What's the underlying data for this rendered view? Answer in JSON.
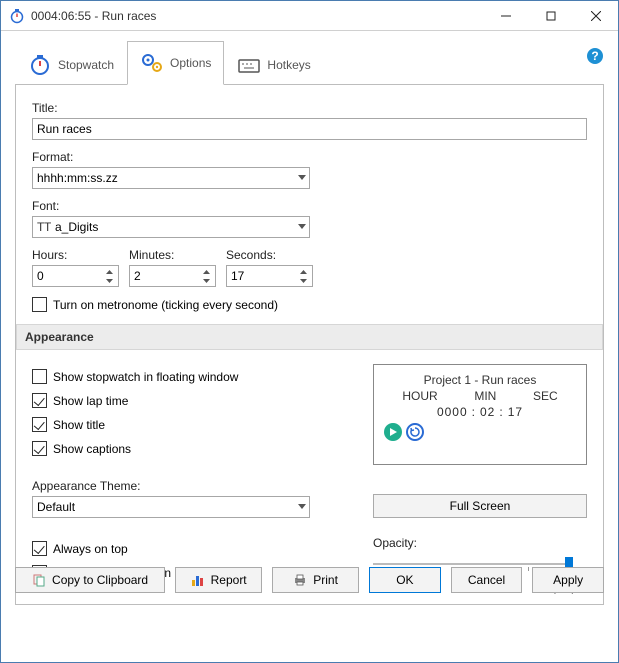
{
  "window": {
    "title": "0004:06:55 - Run races"
  },
  "tabs": {
    "stopwatch": "Stopwatch",
    "options": "Options",
    "hotkeys": "Hotkeys"
  },
  "fields": {
    "title_label": "Title:",
    "title_value": "Run races",
    "format_label": "Format:",
    "format_value": "hhhh:mm:ss.zz",
    "font_label": "Font:",
    "font_value": "a_Digits",
    "hours_label": "Hours:",
    "hours_value": "0",
    "minutes_label": "Minutes:",
    "minutes_value": "2",
    "seconds_label": "Seconds:",
    "seconds_value": "17",
    "metronome": "Turn on metronome (ticking every second)"
  },
  "appearance": {
    "header": "Appearance",
    "floating": "Show stopwatch in floating window",
    "lap": "Show lap time",
    "title": "Show title",
    "captions": "Show captions",
    "theme_label": "Appearance Theme:",
    "theme_value": "Default",
    "fullscreen": "Full Screen",
    "alwaystop": "Always on top",
    "lock": "Lock size and position",
    "opacity_label": "Opacity:",
    "slider_min": "10%",
    "slider_max": "Opaque"
  },
  "preview": {
    "title": "Project 1 - Run races",
    "cap_hour": "HOUR",
    "cap_min": "MIN",
    "cap_sec": "SEC",
    "hour": "0000",
    "min": "02",
    "sec": "17"
  },
  "footer": {
    "copy": "Copy to Clipboard",
    "report": "Report",
    "print": "Print",
    "ok": "OK",
    "cancel": "Cancel",
    "apply": "Apply"
  }
}
